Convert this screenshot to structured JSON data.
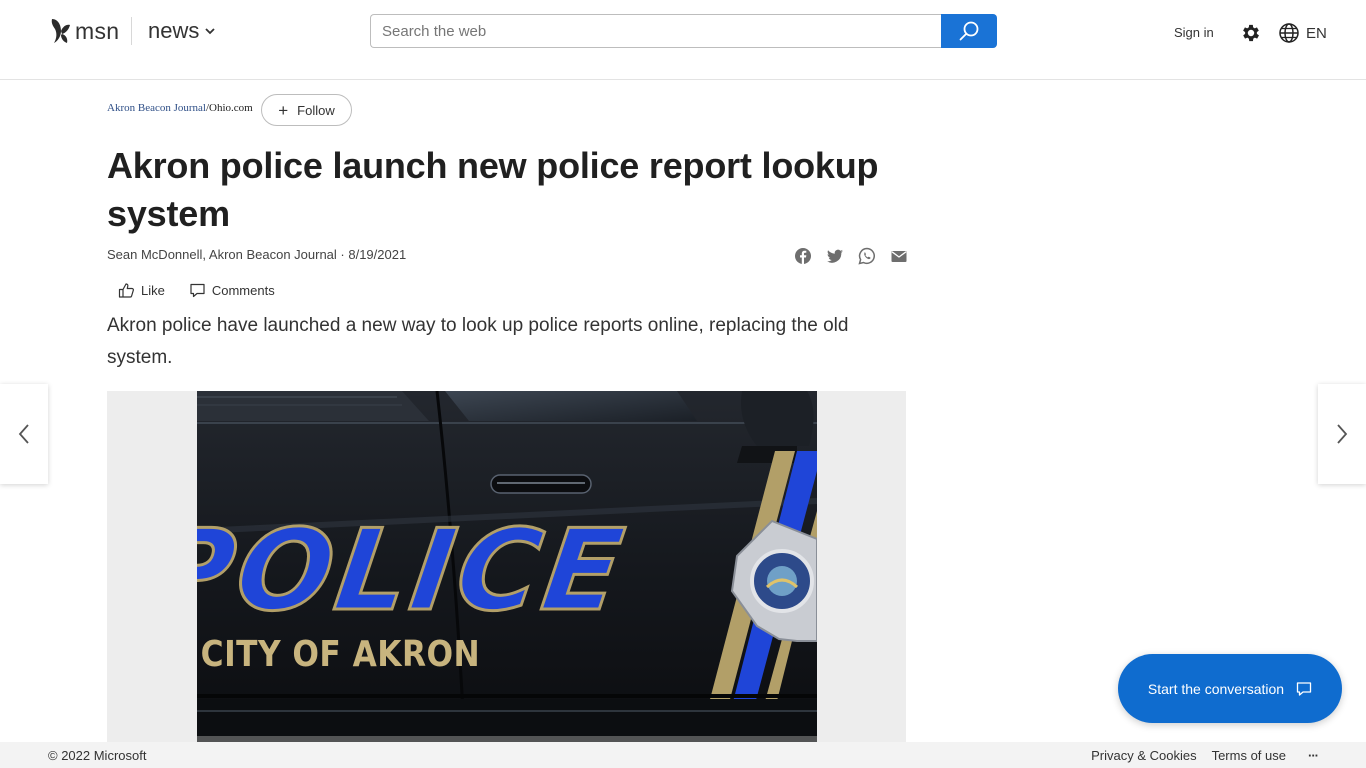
{
  "header": {
    "brand": "msn",
    "section": "news",
    "search_placeholder": "Search the web",
    "signin": "Sign in",
    "language": "EN"
  },
  "article": {
    "publisher_primary": "Akron Beacon Journal",
    "publisher_secondary": "/Ohio.com",
    "follow_label": "Follow",
    "title": "Akron police launch new police report lookup system",
    "byline": "Sean McDonnell, Akron Beacon Journal · 8/19/2021",
    "like_label": "Like",
    "comments_label": "Comments",
    "summary": "Akron police have launched a new way to look up police reports online, replacing the old system.",
    "image_text_police": "POLICE",
    "image_text_city": "CITY OF AKRON"
  },
  "share_icons": [
    "facebook-icon",
    "twitter-icon",
    "whatsapp-icon",
    "mail-icon"
  ],
  "conversation_button": "Start the conversation",
  "footer": {
    "copyright": "© 2022 Microsoft",
    "privacy": "Privacy & Cookies",
    "terms": "Terms of use",
    "more": "···"
  },
  "colors": {
    "accent": "#1a73d6",
    "conversation": "#0f6ccf",
    "police_blue": "#1f45d8",
    "police_gold": "#b29f68"
  }
}
